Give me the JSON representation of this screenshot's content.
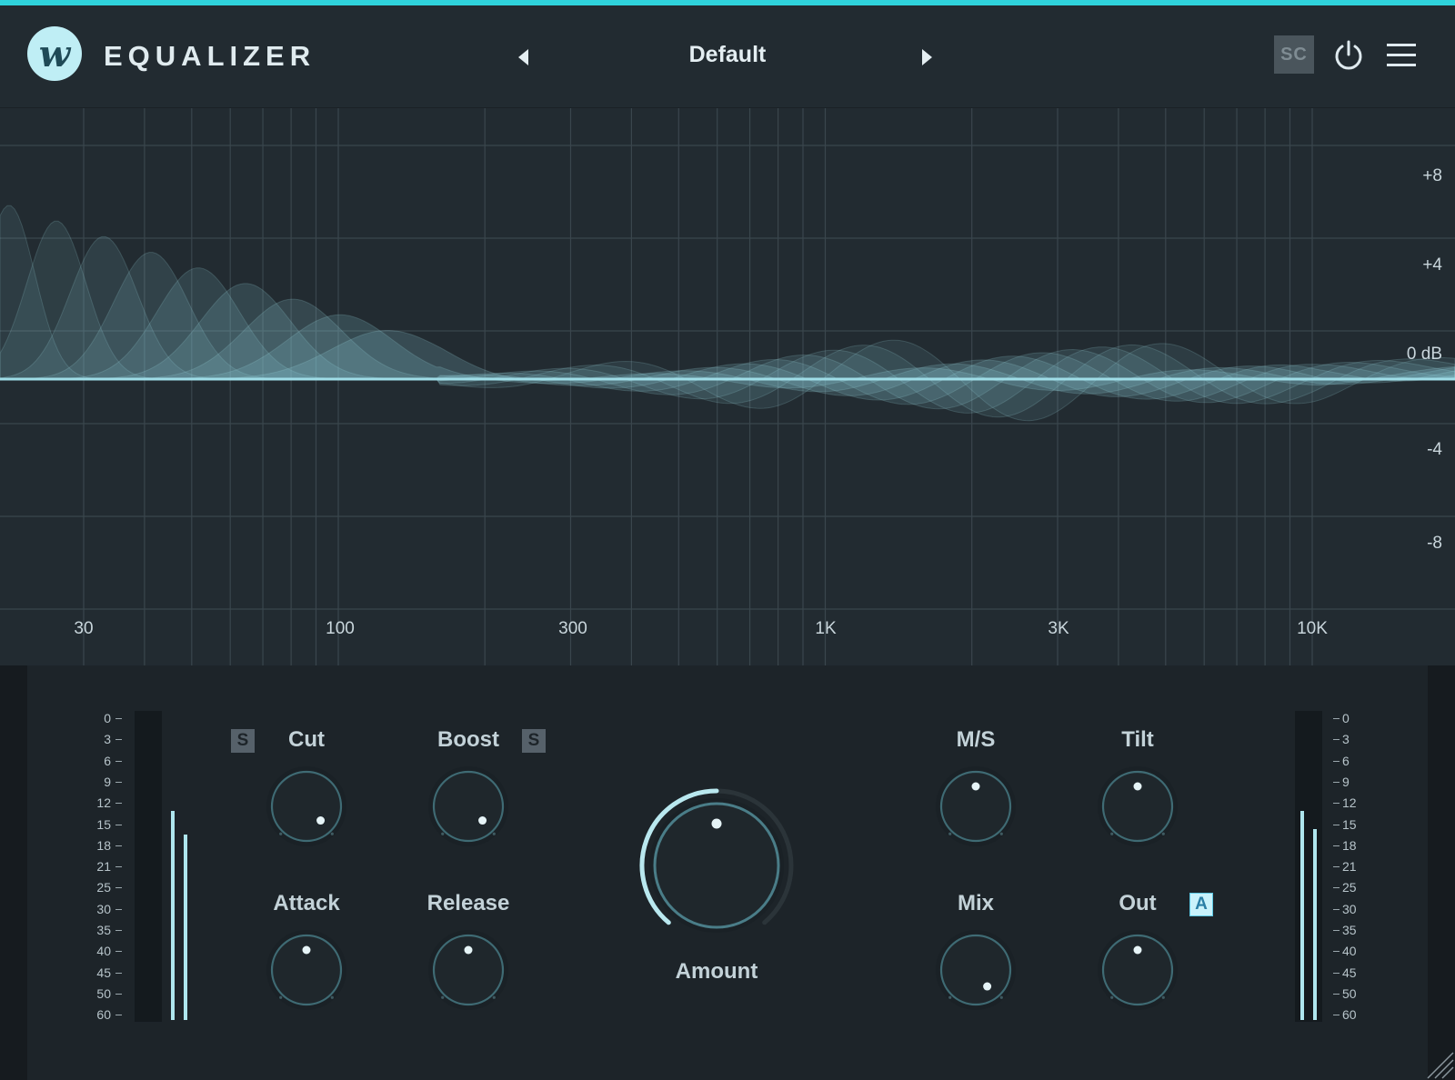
{
  "header": {
    "logo_letter": "w",
    "title": "EQUALIZER",
    "preset": "Default",
    "sc_label": "SC",
    "colors": {
      "accent": "#2fd3dc",
      "curve": "#8fd3df",
      "logo_bg": "#bfeef5"
    }
  },
  "graph": {
    "db_labels": [
      "+8",
      "+4",
      "0 dB",
      "-4",
      "-8"
    ],
    "freq_labels": [
      "30",
      "100",
      "300",
      "1K",
      "3K",
      "10K"
    ]
  },
  "controls": {
    "cut": {
      "label": "Cut",
      "badge": "S"
    },
    "boost": {
      "label": "Boost",
      "badge": "S"
    },
    "attack": {
      "label": "Attack"
    },
    "release": {
      "label": "Release"
    },
    "amount": {
      "label": "Amount"
    },
    "ms": {
      "label": "M/S"
    },
    "tilt": {
      "label": "Tilt"
    },
    "mix": {
      "label": "Mix"
    },
    "out": {
      "label": "Out",
      "badge": "A"
    }
  },
  "meters": {
    "scale": [
      "0",
      "3",
      "6",
      "9",
      "12",
      "15",
      "18",
      "21",
      "25",
      "30",
      "35",
      "40",
      "45",
      "50",
      "60"
    ]
  }
}
